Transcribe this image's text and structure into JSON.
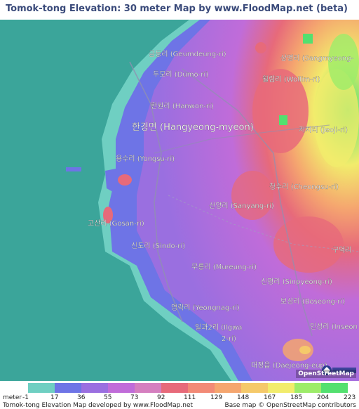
{
  "title": "Tomok-tong Elevation: 30 meter Map by www.FloodMap.net (beta)",
  "map": {
    "labels": [
      {
        "text": "금등리 (Geumdeung-ri)"
      },
      {
        "text": "두모리 (Dumo-ri)"
      },
      {
        "text": "한원리 (Hanwon-ri)"
      },
      {
        "text": "한경면 (Hangyeong-myeon)"
      },
      {
        "text": "용수리 (Yongsu-ri)"
      },
      {
        "text": "고산리 (Gosan-ri)"
      },
      {
        "text": "신도리 (Sindo-ri)"
      },
      {
        "text": "무릉리 (Mureung-ri)"
      },
      {
        "text": "영락리 (Yeongnag-ri)"
      },
      {
        "text": "일과2리 (Ilgwa"
      },
      {
        "text": "2-ri)"
      },
      {
        "text": "대정읍 (Daejeong-eup)"
      },
      {
        "text": "상명리 (Sangmyeong-"
      },
      {
        "text": "월림리 (Wollim-ri)"
      },
      {
        "text": "저지리 (Jeoji-ri)"
      },
      {
        "text": "청수리 (Cheongsu-ri)"
      },
      {
        "text": "산양리 (Sanyang-ri)"
      },
      {
        "text": "구억리"
      },
      {
        "text": "신평리 (Sinpyeong-ri)"
      },
      {
        "text": "보성리 (Boseong-ri)"
      },
      {
        "text": "인성리 (Inseon"
      }
    ],
    "osm_credit": "OpenStreetMap"
  },
  "legend": {
    "unit": "meter",
    "ticks": [
      "-1",
      "17",
      "36",
      "55",
      "73",
      "92",
      "111",
      "129",
      "148",
      "167",
      "185",
      "204",
      "223"
    ],
    "colors": [
      "#6fcfc2",
      "#6e74e6",
      "#9a6fe0",
      "#c06cd9",
      "#d57fbf",
      "#e76a7a",
      "#f28a76",
      "#f5a66f",
      "#f5c96a",
      "#f2ec6c",
      "#9dec69",
      "#53e06f"
    ]
  },
  "footer": {
    "left": "Tomok-tong Elevation Map developed by www.FloodMap.net",
    "right": "Base map © OpenStreetMap contributors"
  }
}
